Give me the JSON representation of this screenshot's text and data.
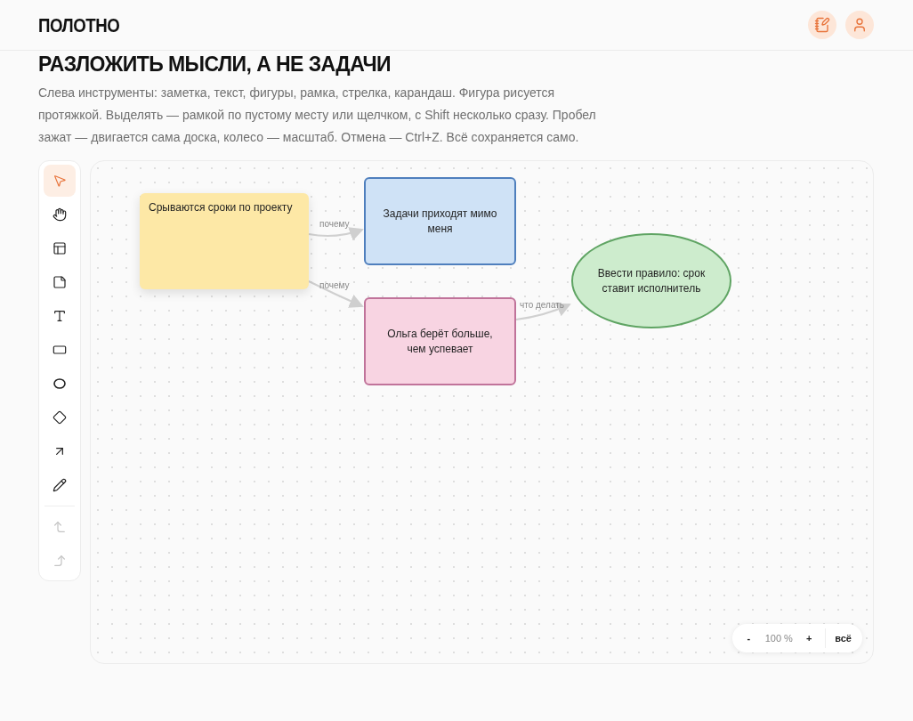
{
  "header": {
    "logo": "ПОЛОТНО"
  },
  "intro": {
    "title": "РАЗЛОЖИТЬ МЫСЛИ, А НЕ ЗАДАЧИ",
    "text": "Слева инструменты: заметка, текст, фигуры, рамка, стрелка, карандаш. Фигура рисуется протяжкой. Выделять — рамкой по пустому месту или щелчком, с Shift несколько сразу. Пробел зажат — двигается сама доска, колесо — масштаб. Отмена — Ctrl+Z. Всё сохраняется само."
  },
  "tools": [
    {
      "kind": "select",
      "selected": true,
      "disabled": false
    },
    {
      "kind": "hand",
      "selected": false,
      "disabled": false
    },
    {
      "kind": "frame",
      "selected": false,
      "disabled": false
    },
    {
      "kind": "note",
      "selected": false,
      "disabled": false
    },
    {
      "kind": "text",
      "selected": false,
      "disabled": false
    },
    {
      "kind": "rect",
      "selected": false,
      "disabled": false
    },
    {
      "kind": "ellipse",
      "selected": false,
      "disabled": false
    },
    {
      "kind": "diamond",
      "selected": false,
      "disabled": false
    },
    {
      "kind": "arrow",
      "selected": false,
      "disabled": false
    },
    {
      "kind": "pencil",
      "selected": false,
      "disabled": false
    },
    {
      "kind": "undo",
      "selected": false,
      "disabled": true
    },
    {
      "kind": "redo",
      "selected": false,
      "disabled": true
    }
  ],
  "nodes": [
    {
      "kind": "sticky",
      "text": "Срываются сроки по проекту",
      "color": "#fde8a6"
    },
    {
      "kind": "rect",
      "text": "Задачи приходят мимо меня",
      "color": "#cfe2f6"
    },
    {
      "kind": "rect",
      "text": "Ольга берёт больше, чем успевает",
      "color": "#f8d4e2"
    },
    {
      "kind": "ellipse",
      "text": "Ввести правило: срок ставит исполнитель",
      "color": "#cdeccd"
    }
  ],
  "edges": [
    {
      "label": "почему"
    },
    {
      "label": "почему"
    },
    {
      "label": "что делать"
    }
  ],
  "zoom": {
    "minus": "-",
    "value": "100 %",
    "plus": "+",
    "fit": "всё"
  }
}
